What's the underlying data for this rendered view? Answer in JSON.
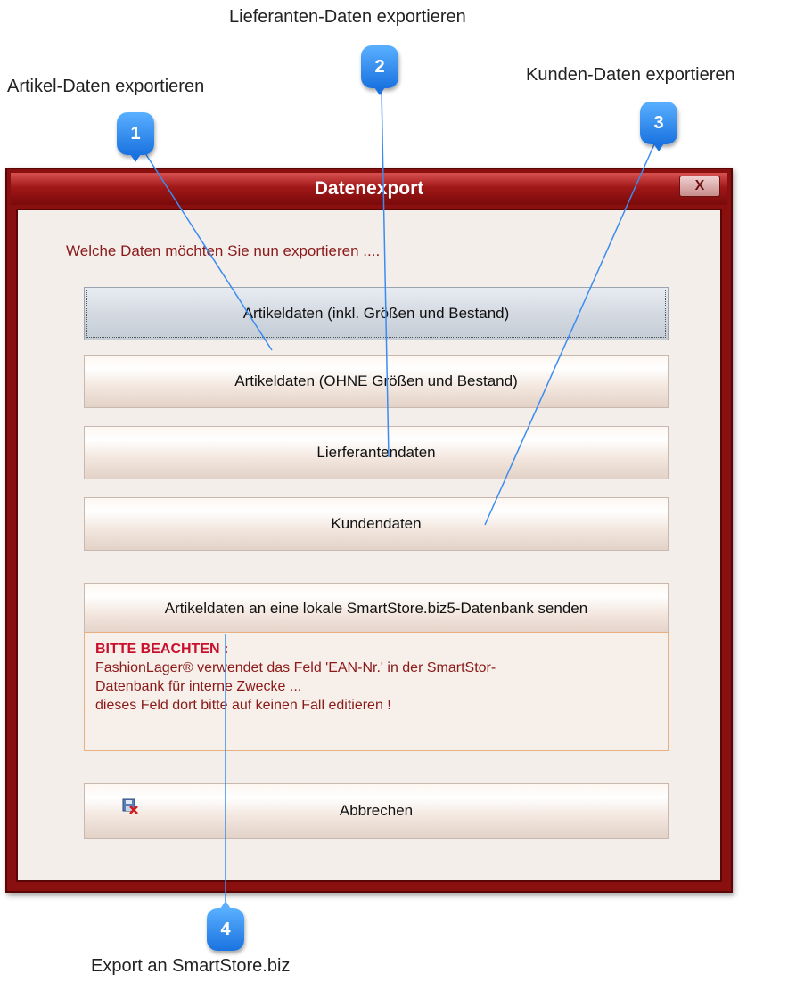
{
  "callouts": [
    {
      "number": "1",
      "label": "Artikel-Daten exportieren"
    },
    {
      "number": "2",
      "label": "Lieferanten-Daten exportieren"
    },
    {
      "number": "3",
      "label": "Kunden-Daten exportieren"
    },
    {
      "number": "4",
      "label": "Export an SmartStore.biz"
    }
  ],
  "window": {
    "title": "Datenexport",
    "close_label": "X"
  },
  "prompt": "Welche Daten möchten Sie nun exportieren ....",
  "buttons": {
    "articles_with_sizes": "Artikeldaten (inkl. Größen und Bestand)",
    "articles_without_sizes": "Artikeldaten (OHNE Größen und Bestand)",
    "suppliers": "Lierferantendaten",
    "customers": "Kundendaten",
    "smartstore": "Artikeldaten an eine lokale SmartStore.biz5-Datenbank senden",
    "cancel": "Abbrechen"
  },
  "note": {
    "title": "BITTE BEACHTEN :",
    "line1": "FashionLager® verwendet das Feld 'EAN-Nr.' in der SmartStor-",
    "line2": "Datenbank für interne Zwecke  ...",
    "line3": "dieses Feld dort bitte auf keinen Fall editieren !"
  },
  "icons": {
    "cancel": "disk-with-red-x-icon"
  }
}
